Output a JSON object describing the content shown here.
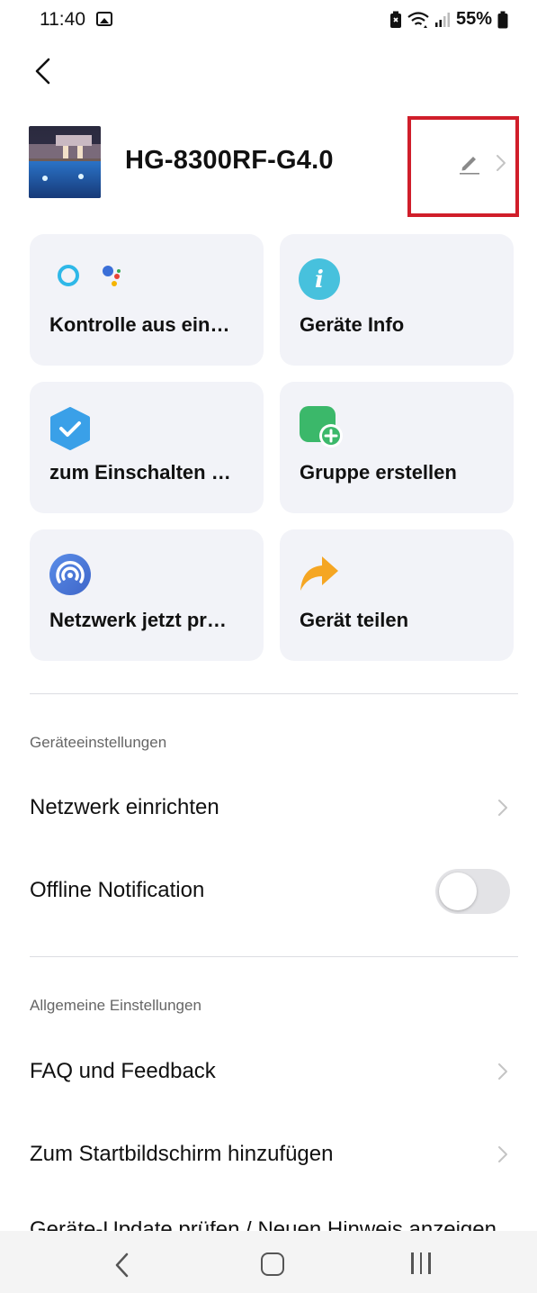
{
  "status_bar": {
    "time": "11:40",
    "battery_percent": "55%",
    "icons": [
      "image-icon",
      "battery-saver-icon",
      "wifi-icon",
      "signal-icon",
      "battery-icon"
    ]
  },
  "header": {
    "device_name": "HG-8300RF-G4.0",
    "edit_icon": "pencil-icon",
    "chevron_icon": "chevron-right-icon"
  },
  "tiles": [
    {
      "label": "Kontrolle aus ein…",
      "icon": "alexa-google-assistant-icon"
    },
    {
      "label": "Geräte Info",
      "icon": "info-icon"
    },
    {
      "label": "zum Einschalten …",
      "icon": "checkmark-shield-icon"
    },
    {
      "label": "Gruppe erstellen",
      "icon": "add-group-icon"
    },
    {
      "label": "Netzwerk jetzt pr…",
      "icon": "network-check-icon"
    },
    {
      "label": "Gerät teilen",
      "icon": "share-arrow-icon"
    }
  ],
  "device_settings": {
    "section_title": "Geräteeinstellungen",
    "network_setup": "Netzwerk einrichten",
    "offline_notification": "Offline Notification",
    "offline_notification_enabled": false
  },
  "general_settings": {
    "section_title": "Allgemeine Einstellungen",
    "faq": "FAQ und Feedback",
    "add_to_home": "Zum Startbildschirm hinzufügen",
    "partial_row": "Geräte-Update prüfen / Neuen Hinweis anzeigen"
  },
  "colors": {
    "accent_blue": "#3aa0e8",
    "info_cyan": "#47c1dd",
    "group_green": "#3bb86a",
    "share_orange": "#f5a623",
    "highlight_red": "#d01e2a",
    "tile_bg": "#f2f3f8"
  }
}
